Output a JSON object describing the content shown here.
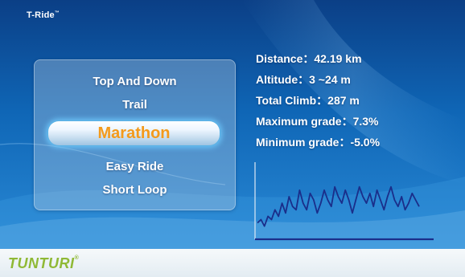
{
  "app": {
    "title": "T-Ride",
    "title_mark": "™"
  },
  "menu": {
    "items": [
      {
        "label": "Top And Down",
        "selected": false
      },
      {
        "label": "Trail",
        "selected": false
      },
      {
        "label": "Marathon",
        "selected": true
      },
      {
        "label": "Easy Ride",
        "selected": false
      },
      {
        "label": "Short Loop",
        "selected": false
      }
    ]
  },
  "stats": {
    "distance": "Distance：42.19 km",
    "altitude": "Altitude：3 ~24 m",
    "total_climb": "Total Climb：287 m",
    "max_grade": "Maximum grade：7.3%",
    "min_grade": "Minimum grade：-5.0%"
  },
  "chart_data": {
    "type": "line",
    "title": "",
    "xlabel": "",
    "ylabel": "",
    "ylim": [
      0,
      24
    ],
    "grid": false,
    "series": [
      {
        "values": [
          5,
          6,
          4,
          7,
          6,
          9,
          7,
          11,
          8,
          13,
          10,
          9,
          15,
          11,
          9,
          14,
          12,
          8,
          11,
          15,
          12,
          10,
          16,
          13,
          11,
          15,
          12,
          8,
          12,
          16,
          13,
          11,
          14,
          10,
          15,
          12,
          9,
          13,
          16,
          12,
          10,
          13,
          9,
          11,
          14,
          12,
          10
        ]
      }
    ],
    "colors": {
      "line": "#1a2e8a",
      "baseline": "#1a2e8a",
      "axis": "#dfe9f5"
    }
  },
  "brand": {
    "logo": "TUNTURI",
    "logo_mark": "®",
    "logo_color": "#8fb935"
  }
}
